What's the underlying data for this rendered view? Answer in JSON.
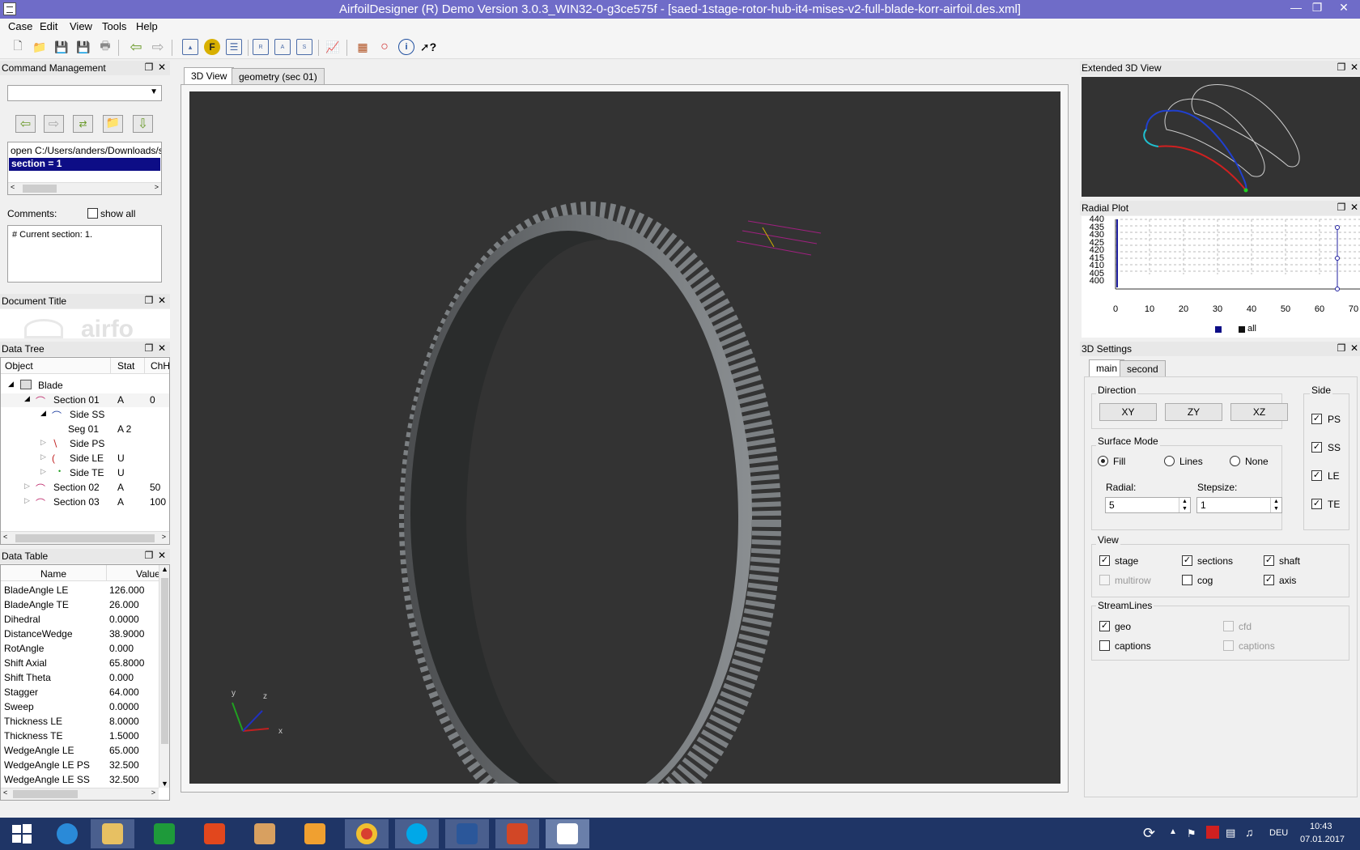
{
  "window": {
    "title": "AirfoilDesigner (R) Demo Version 3.0.3_WIN32-0-g3ce575f - [saed-1stage-rotor-hub-it4-mises-v2-full-blade-korr-airfoil.des.xml]"
  },
  "menu": {
    "case": "Case",
    "edit": "Edit",
    "view": "View",
    "tools": "Tools",
    "help": "Help"
  },
  "command_management": {
    "title": "Command Management",
    "history": [
      "open C:/Users/anders/Downloads/s",
      "section = 1"
    ],
    "comments_label": "Comments:",
    "show_all_label": "show all",
    "comment_text": "# Current section: 1."
  },
  "document_title": {
    "title": "Document Title",
    "watermark": "airfo"
  },
  "data_tree": {
    "title": "Data Tree",
    "columns": [
      "Object",
      "Stat",
      "ChH"
    ],
    "rows": [
      {
        "name": "Blade",
        "stat": "",
        "chh": ""
      },
      {
        "name": "Section 01",
        "stat": "A",
        "chh": "0"
      },
      {
        "name": "Side SS",
        "stat": "",
        "chh": ""
      },
      {
        "name": "Seg 01",
        "stat": "A 2",
        "chh": ""
      },
      {
        "name": "Side PS",
        "stat": "",
        "chh": ""
      },
      {
        "name": "Side LE",
        "stat": "U",
        "chh": ""
      },
      {
        "name": "Side TE",
        "stat": "U",
        "chh": ""
      },
      {
        "name": "Section 02",
        "stat": "A",
        "chh": "50"
      },
      {
        "name": "Section 03",
        "stat": "A",
        "chh": "100"
      }
    ]
  },
  "data_table": {
    "title": "Data Table",
    "columns": [
      "Name",
      "Value"
    ],
    "rows": [
      {
        "name": "BladeAngle LE",
        "value": "126.000"
      },
      {
        "name": "BladeAngle TE",
        "value": "26.000"
      },
      {
        "name": "Dihedral",
        "value": "0.0000"
      },
      {
        "name": "DistanceWedge",
        "value": "38.9000"
      },
      {
        "name": "RotAngle",
        "value": "0.000"
      },
      {
        "name": "Shift Axial",
        "value": "65.8000"
      },
      {
        "name": "Shift Theta",
        "value": "0.000"
      },
      {
        "name": "Stagger",
        "value": "64.000"
      },
      {
        "name": "Sweep",
        "value": "0.0000"
      },
      {
        "name": "Thickness LE",
        "value": "8.0000"
      },
      {
        "name": "Thickness TE",
        "value": "1.5000"
      },
      {
        "name": "WedgeAngle LE",
        "value": "65.000"
      },
      {
        "name": "WedgeAngle LE PS",
        "value": "32.500"
      },
      {
        "name": "WedgeAngle LE SS",
        "value": "32.500"
      }
    ]
  },
  "tabs": {
    "view3d": "3D View",
    "geometry": "geometry (sec 01)"
  },
  "axes": {
    "x": "x",
    "y": "y",
    "z": "z"
  },
  "extended_view": {
    "title": "Extended 3D View"
  },
  "radial_plot": {
    "title": "Radial Plot",
    "y_ticks": [
      "440",
      "435",
      "430",
      "425",
      "420",
      "415",
      "410",
      "405",
      "400"
    ],
    "x_ticks": [
      "0",
      "10",
      "20",
      "30",
      "40",
      "50",
      "60",
      "70"
    ],
    "legend": "all"
  },
  "settings": {
    "title": "3D Settings",
    "tab_main": "main",
    "tab_second": "second",
    "direction_label": "Direction",
    "btn_xy": "XY",
    "btn_zy": "ZY",
    "btn_xz": "XZ",
    "side_label": "Side",
    "side_ps": "PS",
    "side_ss": "SS",
    "side_le": "LE",
    "side_te": "TE",
    "surface_label": "Surface Mode",
    "fill": "Fill",
    "lines": "Lines",
    "none": "None",
    "radial_label": "Radial:",
    "radial_value": "5",
    "stepsize_label": "Stepsize:",
    "stepsize_value": "1",
    "view_label": "View",
    "stage": "stage",
    "sections": "sections",
    "shaft": "shaft",
    "multirow": "multirow",
    "cog": "cog",
    "axis": "axis",
    "streamlines_label": "StreamLines",
    "geo": "geo",
    "cfd": "cfd",
    "captions1": "captions",
    "captions2": "captions"
  },
  "taskbar": {
    "lang": "DEU",
    "time": "10:43",
    "date": "07.01.2017"
  }
}
